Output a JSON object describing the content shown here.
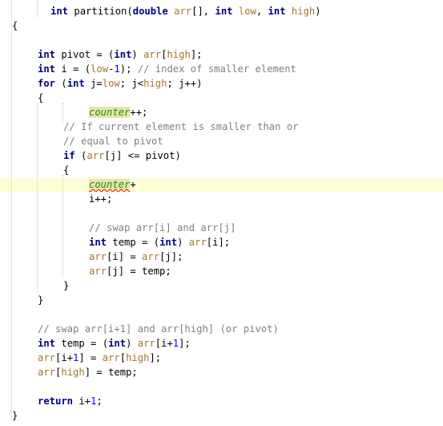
{
  "editor": {
    "language": "Java",
    "current_line_index": 12,
    "lines": [
      {
        "indent": 2,
        "tokens": [
          {
            "t": "int",
            "c": "kw"
          },
          {
            "t": " partition(",
            "c": ""
          },
          {
            "t": "double",
            "c": "kw"
          },
          {
            "t": " ",
            "c": ""
          },
          {
            "t": "arr",
            "c": "param"
          },
          {
            "t": "[], ",
            "c": ""
          },
          {
            "t": "int",
            "c": "kw"
          },
          {
            "t": " ",
            "c": ""
          },
          {
            "t": "low",
            "c": "param"
          },
          {
            "t": ", ",
            "c": ""
          },
          {
            "t": "int",
            "c": "kw"
          },
          {
            "t": " ",
            "c": ""
          },
          {
            "t": "high",
            "c": "param"
          },
          {
            "t": ")",
            "c": ""
          }
        ]
      },
      {
        "indent": 0,
        "tokens": [
          {
            "t": "{",
            "c": ""
          }
        ]
      },
      {
        "indent": 0,
        "tokens": []
      },
      {
        "indent": 1,
        "tokens": [
          {
            "t": "int",
            "c": "kw"
          },
          {
            "t": " pivot = (",
            "c": ""
          },
          {
            "t": "int",
            "c": "kw"
          },
          {
            "t": ") ",
            "c": ""
          },
          {
            "t": "arr",
            "c": "param"
          },
          {
            "t": "[",
            "c": ""
          },
          {
            "t": "high",
            "c": "param"
          },
          {
            "t": "];",
            "c": ""
          }
        ]
      },
      {
        "indent": 1,
        "tokens": [
          {
            "t": "int",
            "c": "kw"
          },
          {
            "t": " i = (",
            "c": ""
          },
          {
            "t": "low",
            "c": "param"
          },
          {
            "t": "-",
            "c": ""
          },
          {
            "t": "1",
            "c": "num"
          },
          {
            "t": "); ",
            "c": ""
          },
          {
            "t": "// index of smaller element",
            "c": "cmt"
          }
        ]
      },
      {
        "indent": 1,
        "tokens": [
          {
            "t": "for",
            "c": "kw"
          },
          {
            "t": " (",
            "c": ""
          },
          {
            "t": "int",
            "c": "kw"
          },
          {
            "t": " j=",
            "c": ""
          },
          {
            "t": "low",
            "c": "param"
          },
          {
            "t": "; j<",
            "c": ""
          },
          {
            "t": "high",
            "c": "param"
          },
          {
            "t": "; j++)",
            "c": ""
          }
        ]
      },
      {
        "indent": 1,
        "tokens": [
          {
            "t": "{",
            "c": ""
          }
        ]
      },
      {
        "indent": 3,
        "tokens": [
          {
            "t": "counter",
            "c": "fld"
          },
          {
            "t": "++;",
            "c": ""
          }
        ]
      },
      {
        "indent": 2,
        "tokens": [
          {
            "t": "// If current element is smaller than or",
            "c": "cmt"
          }
        ]
      },
      {
        "indent": 2,
        "tokens": [
          {
            "t": "// equal to pivot",
            "c": "cmt"
          }
        ]
      },
      {
        "indent": 2,
        "tokens": [
          {
            "t": "if",
            "c": "kw"
          },
          {
            "t": " (",
            "c": ""
          },
          {
            "t": "arr",
            "c": "param"
          },
          {
            "t": "[j] <= pivot)",
            "c": ""
          }
        ]
      },
      {
        "indent": 2,
        "tokens": [
          {
            "t": "{",
            "c": ""
          }
        ]
      },
      {
        "indent": 3,
        "tokens": [
          {
            "t": "counter",
            "c": "fld err"
          },
          {
            "t": "+",
            "c": ""
          }
        ]
      },
      {
        "indent": 3,
        "tokens": [
          {
            "t": "i++;",
            "c": ""
          }
        ]
      },
      {
        "indent": 0,
        "tokens": []
      },
      {
        "indent": 3,
        "tokens": [
          {
            "t": "// swap arr[i] and arr[j]",
            "c": "cmt"
          }
        ]
      },
      {
        "indent": 3,
        "tokens": [
          {
            "t": "int",
            "c": "kw"
          },
          {
            "t": " temp = (",
            "c": ""
          },
          {
            "t": "int",
            "c": "kw"
          },
          {
            "t": ") ",
            "c": ""
          },
          {
            "t": "arr",
            "c": "param"
          },
          {
            "t": "[i];",
            "c": ""
          }
        ]
      },
      {
        "indent": 3,
        "tokens": [
          {
            "t": "arr",
            "c": "param"
          },
          {
            "t": "[i] = ",
            "c": ""
          },
          {
            "t": "arr",
            "c": "param"
          },
          {
            "t": "[j];",
            "c": ""
          }
        ]
      },
      {
        "indent": 3,
        "tokens": [
          {
            "t": "arr",
            "c": "param"
          },
          {
            "t": "[j] = temp;",
            "c": ""
          }
        ]
      },
      {
        "indent": 2,
        "tokens": [
          {
            "t": "}",
            "c": ""
          }
        ]
      },
      {
        "indent": 1,
        "tokens": [
          {
            "t": "}",
            "c": ""
          }
        ]
      },
      {
        "indent": 0,
        "tokens": []
      },
      {
        "indent": 1,
        "tokens": [
          {
            "t": "// swap arr[i+1] and arr[high] (or pivot)",
            "c": "cmt"
          }
        ]
      },
      {
        "indent": 1,
        "tokens": [
          {
            "t": "int",
            "c": "kw"
          },
          {
            "t": " temp = (",
            "c": ""
          },
          {
            "t": "int",
            "c": "kw"
          },
          {
            "t": ") ",
            "c": ""
          },
          {
            "t": "arr",
            "c": "param"
          },
          {
            "t": "[i+",
            "c": ""
          },
          {
            "t": "1",
            "c": "num"
          },
          {
            "t": "];",
            "c": ""
          }
        ]
      },
      {
        "indent": 1,
        "tokens": [
          {
            "t": "arr",
            "c": "param"
          },
          {
            "t": "[i+",
            "c": ""
          },
          {
            "t": "1",
            "c": "num"
          },
          {
            "t": "] = ",
            "c": ""
          },
          {
            "t": "arr",
            "c": "param"
          },
          {
            "t": "[",
            "c": ""
          },
          {
            "t": "high",
            "c": "param"
          },
          {
            "t": "];",
            "c": ""
          }
        ]
      },
      {
        "indent": 1,
        "tokens": [
          {
            "t": "arr",
            "c": "param"
          },
          {
            "t": "[",
            "c": ""
          },
          {
            "t": "high",
            "c": "param"
          },
          {
            "t": "] = temp;",
            "c": ""
          }
        ]
      },
      {
        "indent": 0,
        "tokens": []
      },
      {
        "indent": 1,
        "tokens": [
          {
            "t": "return",
            "c": "kw"
          },
          {
            "t": " i+",
            "c": ""
          },
          {
            "t": "1",
            "c": "num"
          },
          {
            "t": ";",
            "c": ""
          }
        ]
      },
      {
        "indent": 0,
        "tokens": [
          {
            "t": "}",
            "c": ""
          }
        ]
      }
    ]
  },
  "colors": {
    "keyword": "#000080",
    "parameter": "#a0782d",
    "number": "#0000ff",
    "comment": "#808080",
    "field": "#228b22",
    "field_highlight": "#e6e6a8",
    "current_line": "#ffffd7",
    "error_underline": "#e00000"
  }
}
